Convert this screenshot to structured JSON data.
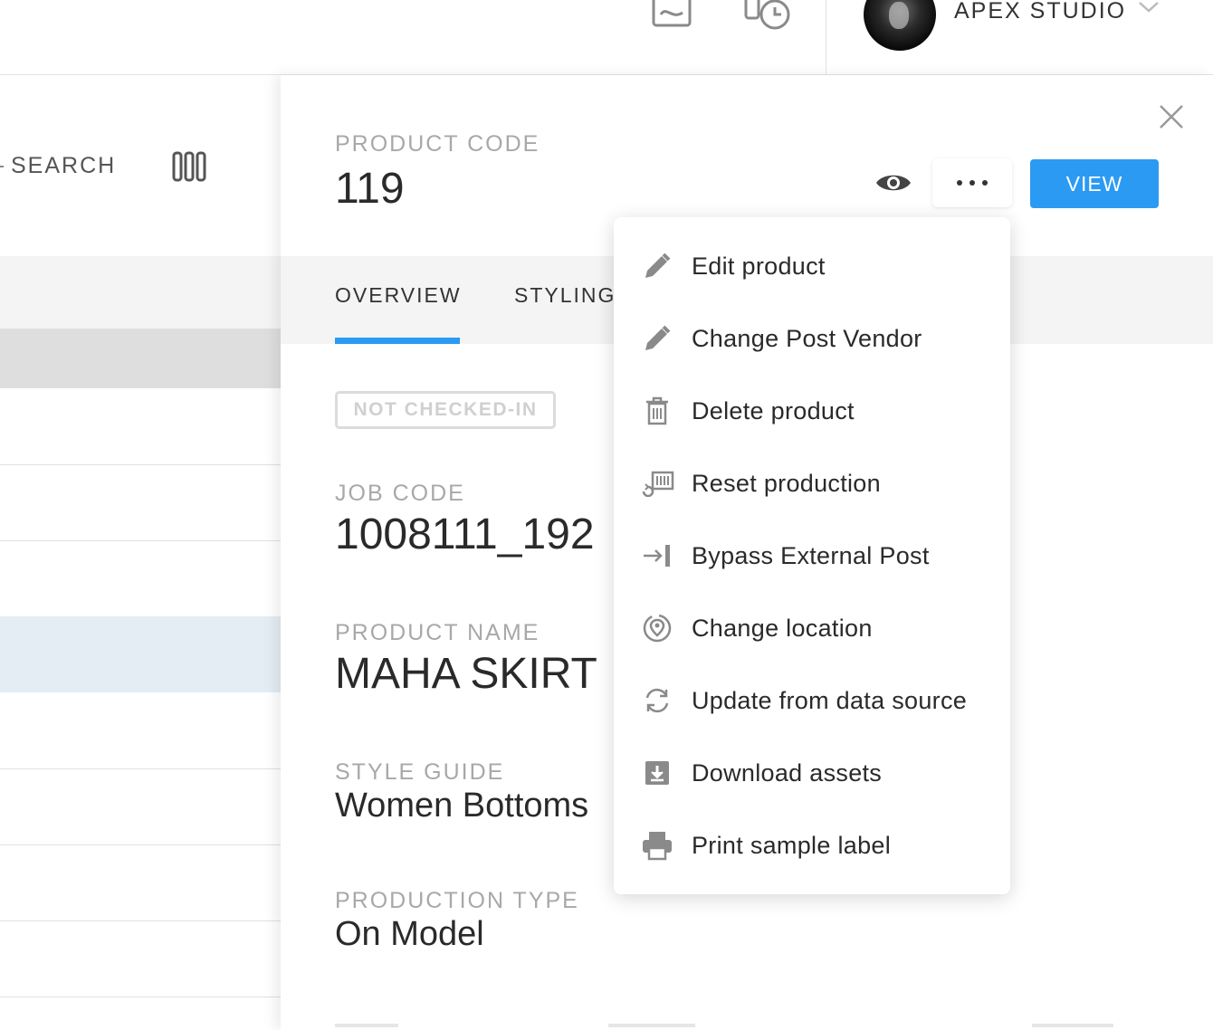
{
  "header": {
    "studio_name": "APEX STUDIO",
    "icons": [
      "chart-icon",
      "device-clock-icon",
      "chevron-down-icon"
    ]
  },
  "left_panel": {
    "search_label": "SEARCH",
    "columns_icon": "columns-icon"
  },
  "detail": {
    "product_code_label": "PRODUCT CODE",
    "product_code": "119",
    "view_button": "VIEW",
    "tabs": [
      {
        "label": "OVERVIEW",
        "active": true
      },
      {
        "label": "STYLING",
        "active": false
      }
    ],
    "status_badge": "NOT CHECKED-IN",
    "fields": [
      {
        "label": "JOB CODE",
        "value": "1008111_192"
      },
      {
        "label": "PRODUCT NAME",
        "value": "MAHA SKIRT"
      },
      {
        "label": "STYLE GUIDE",
        "value": "Women Bottoms"
      },
      {
        "label": "PRODUCTION TYPE",
        "value": "On Model"
      }
    ]
  },
  "menu": {
    "items": [
      {
        "label": "Edit product",
        "icon": "pencil-icon"
      },
      {
        "label": "Change Post Vendor",
        "icon": "pencil-icon"
      },
      {
        "label": "Delete product",
        "icon": "trash-icon"
      },
      {
        "label": "Reset production",
        "icon": "reset-production-icon"
      },
      {
        "label": "Bypass External Post",
        "icon": "bypass-icon"
      },
      {
        "label": "Change location",
        "icon": "location-icon"
      },
      {
        "label": "Update from data source",
        "icon": "refresh-icon"
      },
      {
        "label": "Download assets",
        "icon": "download-icon"
      },
      {
        "label": "Print sample label",
        "icon": "printer-icon"
      }
    ]
  },
  "colors": {
    "accent": "#2b9af3",
    "selected_row": "#e4ecf4",
    "label_gray": "#a8a8a8"
  }
}
